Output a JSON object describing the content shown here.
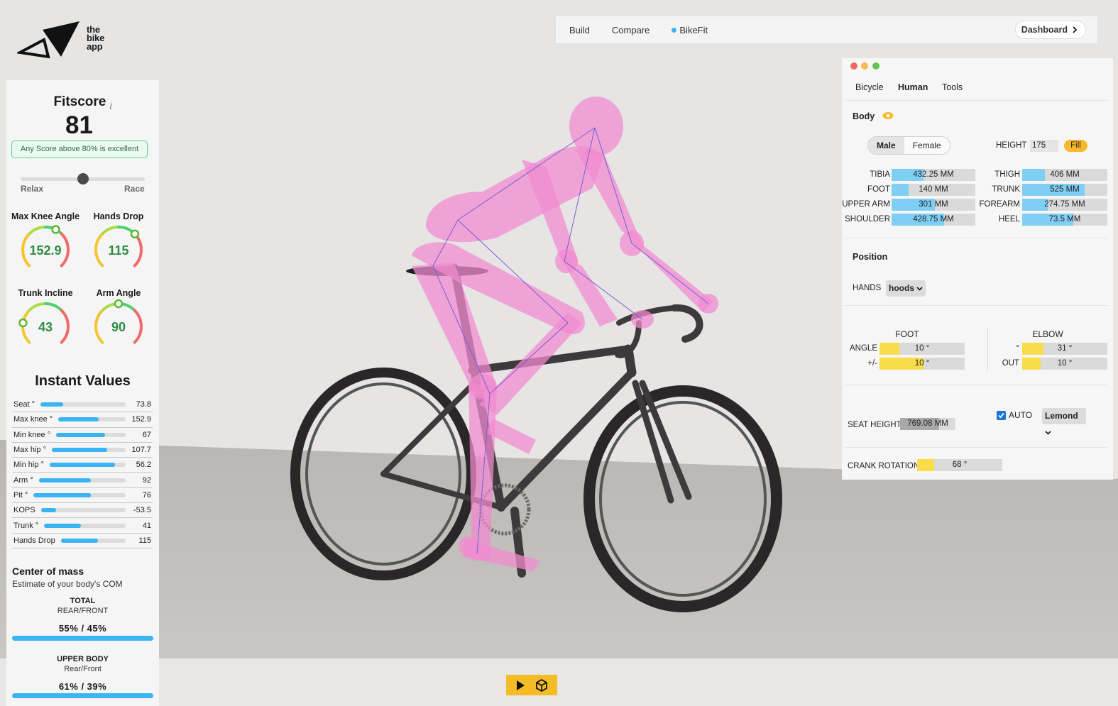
{
  "logo": {
    "line1": "the",
    "line2": "bike",
    "line3": "app"
  },
  "nav": {
    "items": [
      {
        "label": "Build"
      },
      {
        "label": "Compare"
      },
      {
        "label": "BikeFit",
        "active_dot_color": "#3ab4f2"
      }
    ],
    "dashboard_label": "Dashboard"
  },
  "fitscore": {
    "title": "Fitscore",
    "info_glyph": "i",
    "score": "81",
    "badge": "Any Score above 80% is excellent",
    "slider_left": "Relax",
    "slider_right": "Race",
    "slider_value": 0.5
  },
  "gauges": [
    {
      "title": "Max Knee Angle",
      "value": "152.9",
      "marker": 0.6
    },
    {
      "title": "Hands Drop",
      "value": "115",
      "marker": 0.67
    },
    {
      "title": "Trunk Incline",
      "value": "43",
      "marker": 0.2
    },
    {
      "title": "Arm Angle",
      "value": "90",
      "marker": 0.5
    }
  ],
  "instant_values": {
    "title": "Instant Values",
    "rows": [
      {
        "label": "Seat °",
        "value": "73.8",
        "fill": 0.27
      },
      {
        "label": "Max knee °",
        "value": "152.9",
        "fill": 0.6
      },
      {
        "label": "Min knee °",
        "value": "67",
        "fill": 0.7
      },
      {
        "label": "Max hip °",
        "value": "107.7",
        "fill": 0.75
      },
      {
        "label": "Min hip °",
        "value": "56.2",
        "fill": 0.86
      },
      {
        "label": "Arm °",
        "value": "92",
        "fill": 0.6
      },
      {
        "label": "Pit °",
        "value": "76",
        "fill": 0.62
      },
      {
        "label": "KOPS",
        "value": "-53.5",
        "fill": 0.18
      },
      {
        "label": "Trunk °",
        "value": "41",
        "fill": 0.45
      },
      {
        "label": "Hands Drop",
        "value": "115",
        "fill": 0.57
      }
    ]
  },
  "center_of_mass": {
    "title": "Center of mass",
    "subtitle": "Estimate of your body's COM",
    "total_label": "TOTAL",
    "total_sub": "REAR/FRONT",
    "total_value": "55%  /  45%",
    "upper_label": "UPPER BODY",
    "upper_sub": "Rear/Front",
    "upper_value": "61%  /  39%"
  },
  "panel": {
    "window_dots": [
      "#ee6a5f",
      "#f5bd4f",
      "#61c454"
    ],
    "tabs": [
      "Bicycle",
      "Human",
      "Tools"
    ],
    "active_tab": "Human",
    "body_label": "Body",
    "gender": [
      "Male",
      "Female"
    ],
    "height_label": "HEIGHT",
    "height_value": "175",
    "fill_label": "Fill",
    "measurements_left": [
      {
        "label": "TIBIA",
        "value": "432.25 MM",
        "fill": 0.38
      },
      {
        "label": "FOOT",
        "value": "140 MM",
        "fill": 0.2
      },
      {
        "label": "UPPER ARM",
        "value": "301 MM",
        "fill": 0.52
      },
      {
        "label": "SHOULDER",
        "value": "428.75 MM",
        "fill": 0.63
      }
    ],
    "measurements_right": [
      {
        "label": "THIGH",
        "value": "406 MM",
        "fill": 0.27
      },
      {
        "label": "TRUNK",
        "value": "525 MM",
        "fill": 0.73
      },
      {
        "label": "FOREARM",
        "value": "274.75 MM",
        "fill": 0.3
      },
      {
        "label": "HEEL",
        "value": "73.5 MM",
        "fill": 0.6
      }
    ],
    "position_label": "Position",
    "hands_label": "HANDS",
    "hands_value": "hoods",
    "foot_label": "FOOT",
    "elbow_label": "ELBOW",
    "foot_rows": [
      {
        "label": "ANGLE",
        "value": "10 °",
        "fill": 0.23
      },
      {
        "label": "+/-",
        "value": "10 °",
        "fill": 0.52
      }
    ],
    "elbow_rows": [
      {
        "label": "°",
        "value": "31 °",
        "fill": 0.25
      },
      {
        "label": "OUT",
        "value": "10 °",
        "fill": 0.22
      }
    ],
    "seat_height_label": "SEAT HEIGHT",
    "seat_height_value": "769.08",
    "seat_height_unit": "MM",
    "seat_height_fill": 0.7,
    "auto_label": "AUTO",
    "auto_checked": true,
    "method_value": "Lemond",
    "crank_label": "CRANK ROTATION",
    "crank_value": "68 °",
    "crank_fill": 0.2
  },
  "colors": {
    "accent_blue": "#3ab4f2",
    "accent_yellow": "#f6bc26",
    "body_pink": "#f28bd0",
    "gauge_green": "#2e8b45"
  }
}
